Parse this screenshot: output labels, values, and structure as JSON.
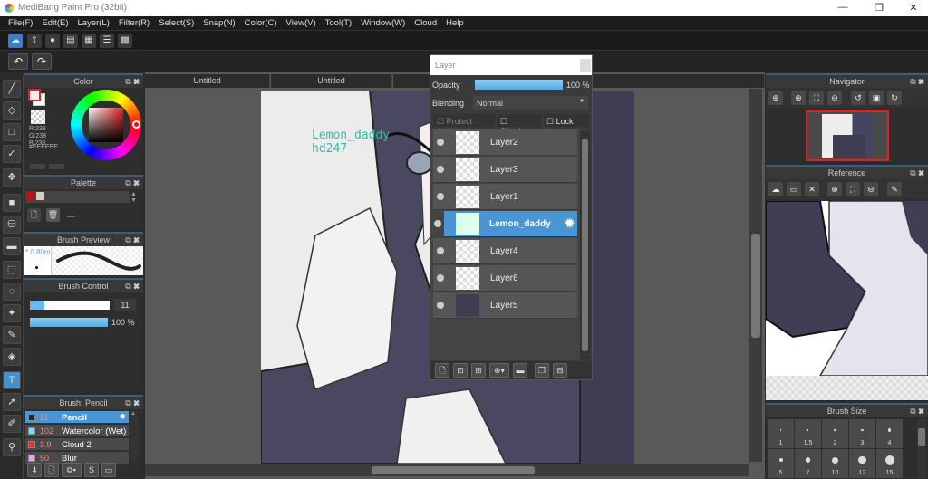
{
  "app": {
    "title": "MediBang Paint Pro (32bit)",
    "min": "—",
    "restore": "❐",
    "close": "✕"
  },
  "menu": [
    "File(F)",
    "Edit(E)",
    "Layer(L)",
    "Filter(R)",
    "Select(S)",
    "Snap(N)",
    "Color(C)",
    "View(V)",
    "Tool(T)",
    "Window(W)",
    "Cloud",
    "Help"
  ],
  "tabs": [
    "Untitled",
    "Untitled"
  ],
  "color_panel": {
    "title": "Color",
    "r": "R:238",
    "g": "G:238",
    "b": "B:238",
    "hex": "#EEEEEE",
    "current": "#eeeeee"
  },
  "palette": {
    "title": "Palette",
    "label": "---"
  },
  "brush_preview": {
    "title": "Brush Preview",
    "size": "* 0.80m"
  },
  "brush_control": {
    "title": "Brush Control",
    "size": "11",
    "size_fraction": 0.18,
    "opacity": "100 %",
    "opacity_fraction": 1.0
  },
  "brush_list": {
    "title": "Brush: Pencil",
    "items": [
      {
        "size": "11",
        "name": "Pencil",
        "color": "#2a2a2a",
        "selected": true
      },
      {
        "size": "102",
        "name": "Watercolor (Wet)",
        "color": "#7fd9f0"
      },
      {
        "size": "3.9",
        "name": "Cloud 2",
        "color": "#e53030"
      },
      {
        "size": "50",
        "name": "Blur",
        "color": "#f0a0f0"
      }
    ]
  },
  "canvas": {
    "watermark_line1": "Lemon_daddy",
    "watermark_line2": "hd247"
  },
  "layer_panel": {
    "title": "Layer",
    "opacity_label": "Opacity",
    "opacity": "100 %",
    "blending_label": "Blending",
    "blending": "Normal",
    "protect_alpha": "Protect Alpha",
    "clipping": "Clipping",
    "lock": "Lock",
    "layers": [
      "Layer2",
      "Layer3",
      "Layer1",
      "Lemon_daddy",
      "Layer4",
      "Layer6",
      "Layer5"
    ],
    "selected": "Lemon_daddy"
  },
  "navigator": {
    "title": "Navigator"
  },
  "reference": {
    "title": "Reference"
  },
  "brush_size": {
    "title": "Brush Size",
    "sizes": [
      "1",
      "1.5",
      "2",
      "3",
      "4",
      "5",
      "7",
      "10",
      "12",
      "15"
    ]
  }
}
